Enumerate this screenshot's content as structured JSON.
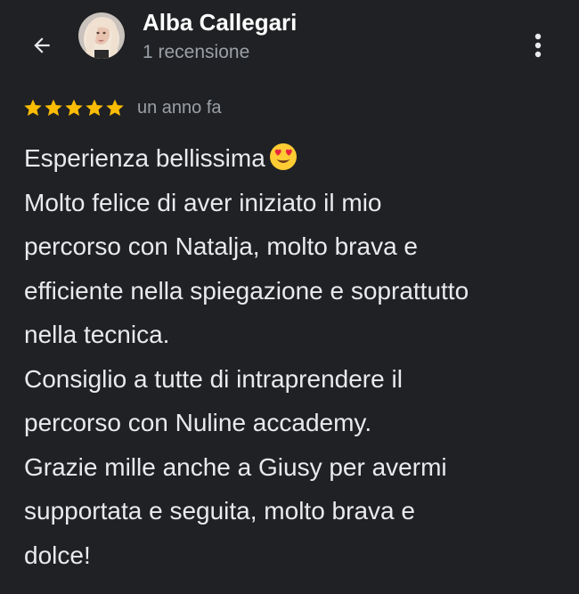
{
  "header": {
    "back_icon": "arrow-back-icon",
    "avatar_icon": "user-avatar",
    "name": "Alba Callegari",
    "review_count": "1 recensione",
    "more_icon": "more-vert-icon"
  },
  "review": {
    "rating": 5,
    "rating_max": 5,
    "star_color": "#fbbc04",
    "date": "un anno fa",
    "emoji_icon": "heart-eyes-emoji",
    "lines": [
      "Esperienza bellissima",
      "Molto felice di aver iniziato il mio",
      "percorso con Natalja, molto brava e",
      "efficiente nella spiegazione e soprattutto",
      "nella tecnica.",
      "Consiglio a tutte di intraprendere il",
      "percorso con Nuline accademy.",
      "Grazie mille anche a Giusy per avermi",
      "supportata e seguita, molto brava e",
      "dolce!"
    ]
  },
  "colors": {
    "background": "#202124",
    "primary_text": "#e8eaed",
    "secondary_text": "#9aa0a6",
    "star": "#fbbc04"
  }
}
